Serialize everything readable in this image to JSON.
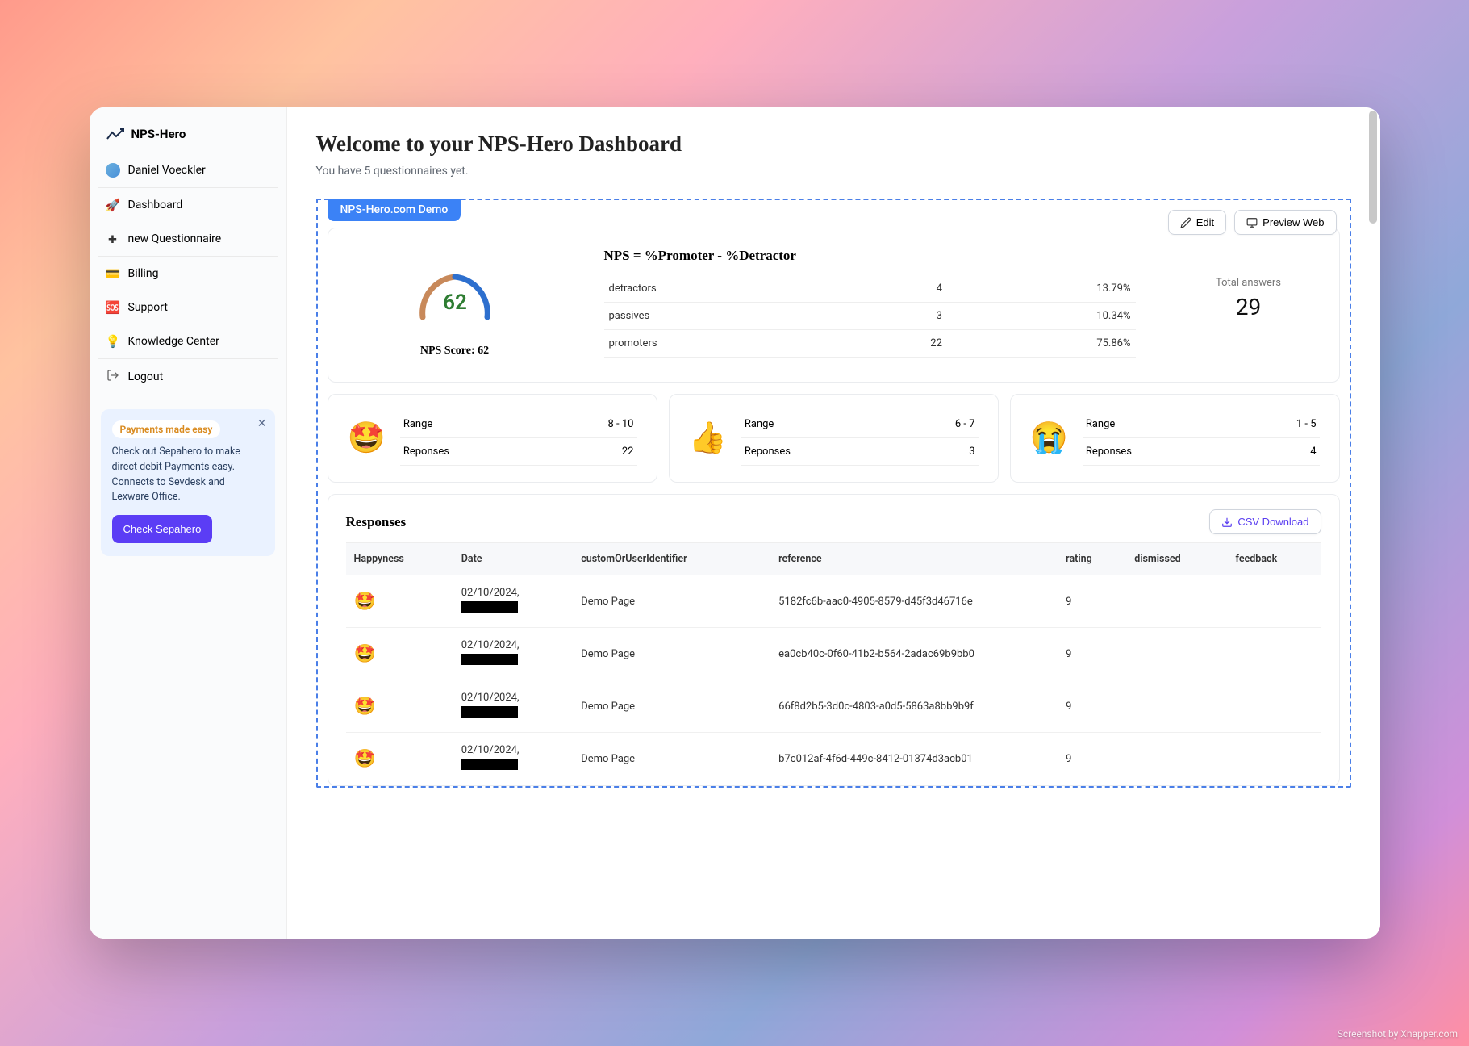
{
  "brand": {
    "name": "NPS-Hero",
    "logo_sub": "NPSHero"
  },
  "user": {
    "name": "Daniel Voeckler"
  },
  "sidebar": {
    "items": [
      {
        "icon": "🚀",
        "label": "Dashboard"
      },
      {
        "icon": "plus",
        "label": "new Questionnaire"
      }
    ],
    "section2": [
      {
        "icon": "💳",
        "label": "Billing"
      },
      {
        "icon": "🆘",
        "label": "Support"
      },
      {
        "icon": "💡",
        "label": "Knowledge Center"
      }
    ],
    "logout": "Logout"
  },
  "promo": {
    "badge": "Payments made easy",
    "desc": "Check out Sepahero to make direct debit Payments easy. Connects to Sevdesk and Lexware Office.",
    "cta": "Check Sepahero"
  },
  "header": {
    "title": "Welcome to your NPS-Hero Dashboard",
    "sub_prefix": "You have ",
    "sub_count": "5",
    "sub_suffix": " questionnaires yet."
  },
  "demo_chip": "NPS-Hero.com Demo",
  "actions": {
    "edit": "Edit",
    "preview": "Preview Web",
    "csv": "CSV Download"
  },
  "gauge": {
    "value": "62",
    "label": "NPS Score: 62"
  },
  "nps": {
    "formula": "NPS = %Promoter - %Detractor",
    "rows": [
      {
        "label": "detractors",
        "count": "4",
        "pct": "13.79%"
      },
      {
        "label": "passives",
        "count": "3",
        "pct": "10.34%"
      },
      {
        "label": "promoters",
        "count": "22",
        "pct": "75.86%"
      }
    ],
    "total_label": "Total answers",
    "total": "29"
  },
  "ranges": [
    {
      "emoji": "🤩",
      "range_label": "Range",
      "range": "8 - 10",
      "responses_label": "Reponses",
      "responses": "22"
    },
    {
      "emoji": "👍",
      "range_label": "Range",
      "range": "6 - 7",
      "responses_label": "Reponses",
      "responses": "3"
    },
    {
      "emoji": "😭",
      "range_label": "Range",
      "range": "1 - 5",
      "responses_label": "Reponses",
      "responses": "4"
    }
  ],
  "responses": {
    "title": "Responses",
    "columns": [
      "Happyness",
      "Date",
      "customOrUserIdentifier",
      "reference",
      "rating",
      "dismissed",
      "feedback"
    ],
    "rows": [
      {
        "date": "02/10/2024,",
        "identifier": "Demo Page",
        "reference": "5182fc6b-aac0-4905-8579-d45f3d46716e",
        "rating": "9"
      },
      {
        "date": "02/10/2024,",
        "identifier": "Demo Page",
        "reference": "ea0cb40c-0f60-41b2-b564-2adac69b9bb0",
        "rating": "9"
      },
      {
        "date": "02/10/2024,",
        "identifier": "Demo Page",
        "reference": "66f8d2b5-3d0c-4803-a0d5-5863a8bb9b9f",
        "rating": "9"
      },
      {
        "date": "02/10/2024,",
        "identifier": "Demo Page",
        "reference": "b7c012af-4f6d-449c-8412-01374d3acb01",
        "rating": "9"
      }
    ]
  },
  "watermark": "Screenshot by Xnapper.com"
}
